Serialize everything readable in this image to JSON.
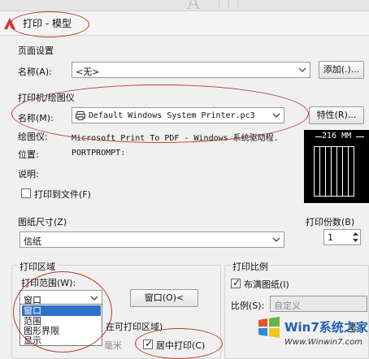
{
  "window": {
    "title": "打印 - 模型"
  },
  "page_setup": {
    "heading": "页面设置",
    "name_label": "名称(A):",
    "name_value": "<无>",
    "add_button": "添加(.)..."
  },
  "printer": {
    "heading": "打印机/绘图仪",
    "name_label": "名称(M):",
    "name_value": "Default Windows System Printer.pc3",
    "properties_button": "特性(R)...",
    "plotter_label": "绘图仪:",
    "plotter_value": "Microsoft Print To PDF - Windows 系统驱动程.",
    "location_label": "位置:",
    "location_value": "PORTPROMPT:",
    "description_label": "说明:",
    "print_to_file_label": "打印到文件(F)",
    "preview_dimension": "216 MM"
  },
  "paper_size": {
    "heading": "图纸尺寸(Z)",
    "value": "信纸"
  },
  "copies": {
    "heading": "打印份数(B)",
    "value": "1"
  },
  "plot_area": {
    "heading": "打印区域",
    "range_label": "打印范围(W):",
    "range_value": "窗口",
    "window_button": "窗口(O)<",
    "options": [
      "窗口",
      "范围",
      "图形界限",
      "显示"
    ],
    "selected_index": 0
  },
  "plot_offset": {
    "heading_partial": "在可打印区域)",
    "center_label": "居中打印(C)",
    "center_checked": true,
    "unit_partial": "毫米"
  },
  "plot_scale": {
    "heading": "打印比例",
    "fit_label": "布满图纸(I)",
    "fit_checked": true,
    "scale_label": "比例(S):",
    "scale_value": "自定义",
    "row_partial": "毫"
  },
  "watermark": {
    "brand": "Win7系统之家",
    "url": "Www.Winwin7.com"
  }
}
